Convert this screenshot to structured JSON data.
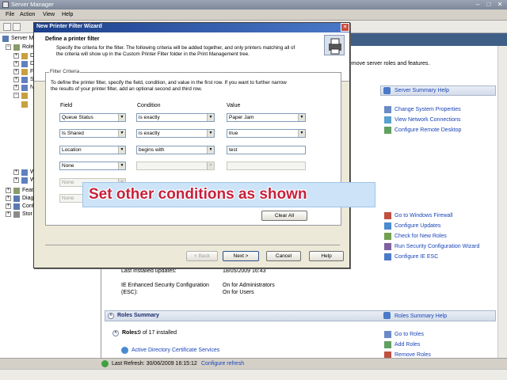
{
  "window": {
    "title": "Server Manager"
  },
  "menu": [
    "File",
    "Action",
    "View",
    "Help"
  ],
  "tree": {
    "root": "Server M",
    "items": [
      "Role",
      "D",
      "D",
      "F",
      "S",
      "N",
      "W",
      "W",
      "W"
    ],
    "bottom": [
      "Feat",
      "Diag",
      "Conf",
      "Stor"
    ]
  },
  "right": {
    "intro_text": "emove server roles and features.",
    "server_summary_help": "Server Summary Help",
    "actions_top": [
      "Change System Properties",
      "View Network Connections",
      "Configure Remote Desktop"
    ],
    "actions_security": [
      "Go to Windows Firewall",
      "Configure Updates",
      "Check for New Roles",
      "Run Security Configuration Wizard",
      "Configure IE ESC"
    ],
    "last_installed_label": "Last installed updates:",
    "last_installed_value": "18/05/2009 16:43",
    "ie_esc_label": "IE Enhanced Security Configuration",
    "ie_esc_label2": "(ESC):",
    "ie_esc_value1": "On for Administrators",
    "ie_esc_value2": "On for Users",
    "roles_summary_title": "Roles Summary",
    "roles_summary_help": "Roles Summary Help",
    "roles_label": "Roles:",
    "roles_count": "9 of 17 installed",
    "role_first": "Active Directory Certificate Services",
    "roles_actions": [
      "Go to Roles",
      "Add Roles",
      "Remove Roles"
    ]
  },
  "status": {
    "last_refresh": "Last Refresh: 30/06/2009 16:15:12",
    "configure_refresh": "Configure refresh"
  },
  "wizard": {
    "title": "New Printer Filter Wizard",
    "heading": "Define a printer filter",
    "desc1": "Specify the criteria for the filter. The following criteria will be added together, and only printers matching all of",
    "desc2": "the criteria will show up in the Custom Printer Filter folder in the Print Management tree.",
    "group_title": "Filter Criteria",
    "instr1": "To define the printer filter, specify the field, condition, and value in the first row. If you want to further narrow",
    "instr2": "the results of your printer filter, add an optional second and third row.",
    "col_field": "Field",
    "col_condition": "Condition",
    "col_value": "Value",
    "rows": [
      {
        "field": "Queue Status",
        "condition": "is exactly",
        "value": "Paper Jam"
      },
      {
        "field": "Is Shared",
        "condition": "is exactly",
        "value": "true"
      },
      {
        "field": "Location",
        "condition": "begins with",
        "value": "test"
      },
      {
        "field": "None",
        "condition": "",
        "value": ""
      },
      {
        "field": "None",
        "condition": "",
        "value": ""
      },
      {
        "field": "None",
        "condition": "",
        "value": ""
      }
    ],
    "clear_all": "Clear All",
    "back": "< Back",
    "next": "Next >",
    "cancel": "Cancel",
    "help": "Help",
    "close": "✕"
  },
  "caption": "Set other conditions as shown"
}
